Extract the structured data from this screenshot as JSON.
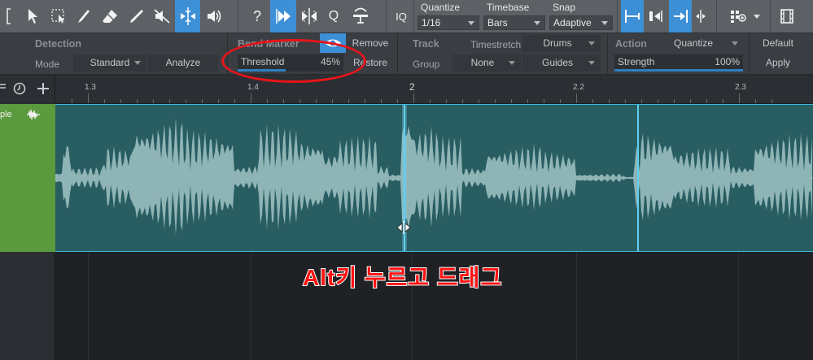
{
  "toolbar": {
    "tools": [
      "bracket-icon",
      "arrow-tool-icon",
      "range-tool-icon",
      "split-tool-icon",
      "eraser-tool-icon",
      "paint-tool-icon",
      "mute-tool-icon",
      "bend-tool-icon",
      "listen-tool-icon"
    ],
    "help_label": "?",
    "q_label": "Q",
    "iq_label": "IQ",
    "quantize_title": "Quantize",
    "quantize_value": "1/16",
    "timebase_title": "Timebase",
    "timebase_value": "Bars",
    "snap_title": "Snap",
    "snap_value": "Adaptive"
  },
  "inspector": {
    "detection": {
      "title": "Detection",
      "mode_label": "Mode",
      "mode_value": "Standard",
      "analyze_label": "Analyze"
    },
    "bend_marker": {
      "title": "Bend Marker",
      "remove_label": "Remove",
      "restore_label": "Restore",
      "threshold_label": "Threshold",
      "threshold_value": "45%",
      "threshold_fraction": 0.45
    },
    "track": {
      "title": "Track",
      "timestretch_label": "Timestretch",
      "timestretch_value": "Drums",
      "group_label": "Group",
      "group_value": "None",
      "guides_label": "Guides"
    },
    "action": {
      "title": "Action",
      "quantize_label": "Quantize",
      "default_label": "Default",
      "strength_label": "Strength",
      "strength_value": "100%",
      "strength_fraction": 1.0,
      "apply_label": "Apply"
    }
  },
  "ruler": {
    "marks": [
      "1.3",
      "1.4",
      "2",
      "2.2",
      "2.3"
    ]
  },
  "track": {
    "name_fragment": "ple"
  },
  "annotation": "Alt키 누르고 드래그",
  "colors": {
    "accent": "#3d8fd6",
    "event_bg": "#285d62",
    "waveform": "#8fb4b5",
    "track_color": "#5b9a3e",
    "annotation": "#ff1010"
  }
}
